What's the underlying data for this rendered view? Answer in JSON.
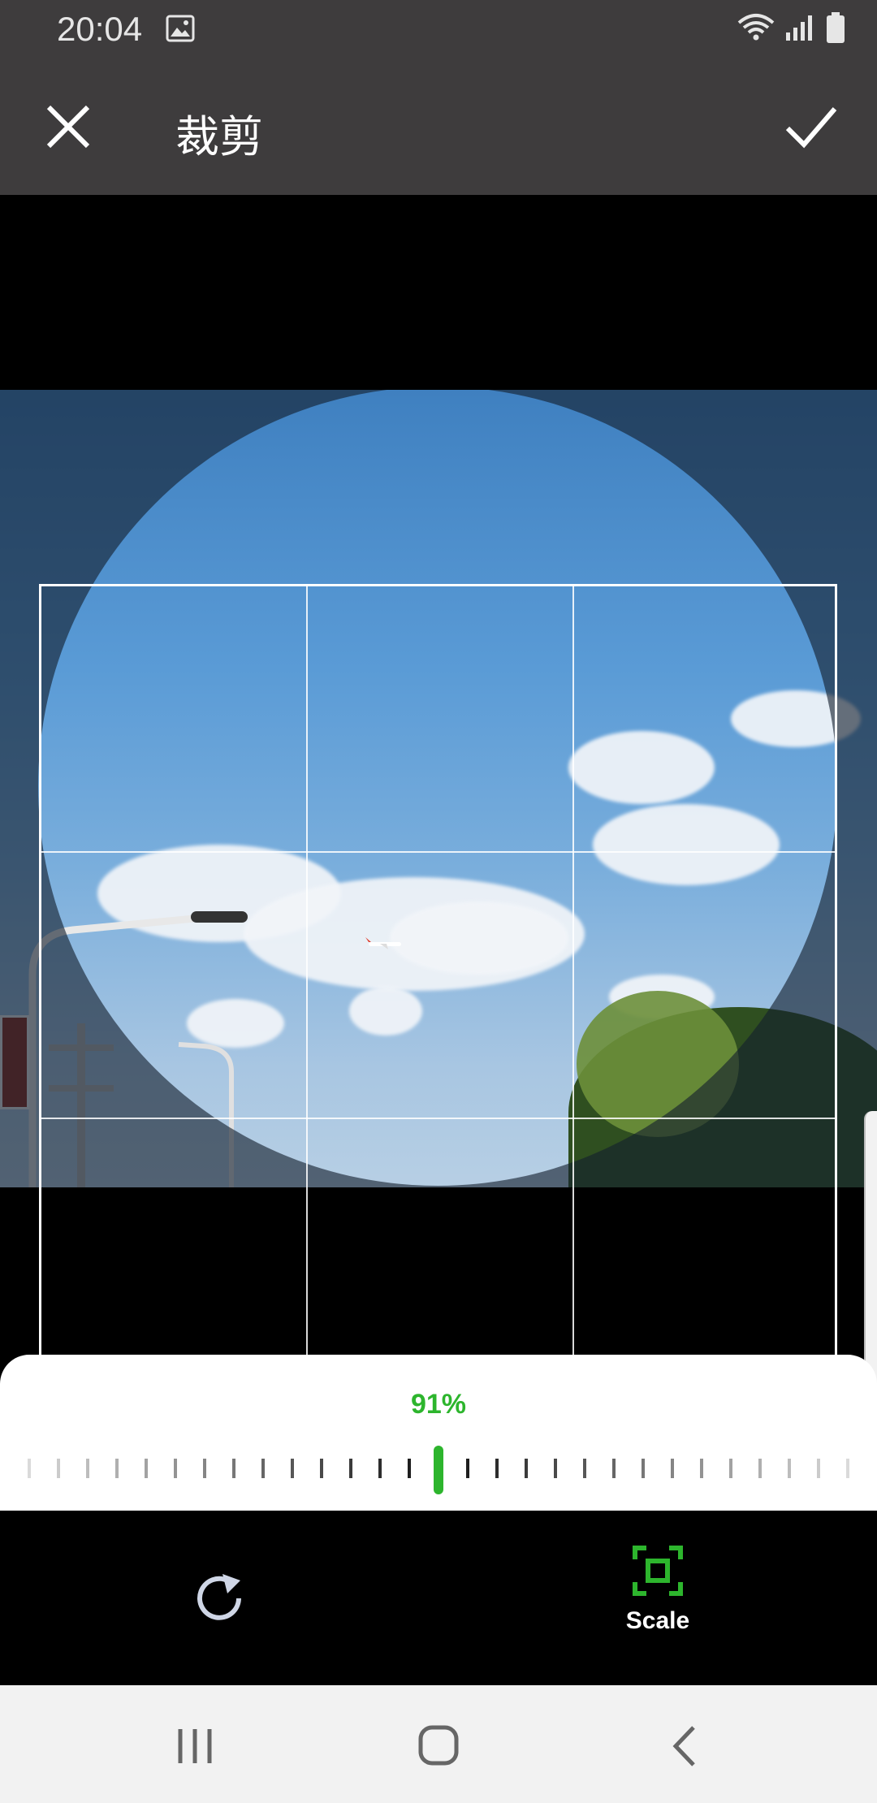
{
  "status": {
    "time": "20:04",
    "icons": [
      "image-icon",
      "wifi-icon",
      "signal-icon",
      "battery-icon"
    ]
  },
  "app_bar": {
    "title": "裁剪",
    "close_icon": "close-icon",
    "confirm_icon": "check-icon"
  },
  "crop": {
    "shape": "circle",
    "grid": "3x3"
  },
  "scale": {
    "value": "91%",
    "level": 0.91,
    "accent": "#2db52d"
  },
  "toolbar": {
    "rotate_icon": "rotate-icon",
    "scale_label": "Scale",
    "scale_icon": "scale-icon"
  },
  "nav": {
    "recents": "recents-icon",
    "home": "home-icon",
    "back": "back-icon"
  },
  "colors": {
    "bar": "#3e3c3d",
    "accent": "#2db52d"
  }
}
